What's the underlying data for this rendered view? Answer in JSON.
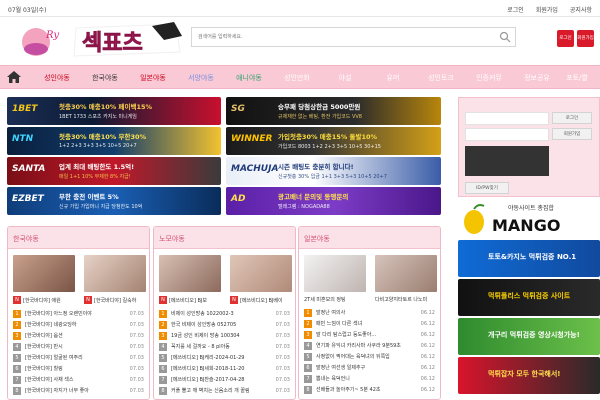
{
  "top": {
    "date": "07월 03일(수)",
    "links": [
      "로그인",
      "회원가입",
      "공지사항"
    ]
  },
  "logo": {
    "script": "Ry",
    "text": "섹표츠"
  },
  "search": {
    "placeholder": "검색어를 입력하세요."
  },
  "header_buttons": [
    "로그인",
    "회원가입"
  ],
  "nav": {
    "items": [
      "성인야동",
      "한국야동",
      "일본야동",
      "서양야동",
      "애니야동",
      "성인만화",
      "야설",
      "유머",
      "성인토크",
      "인증커뮤",
      "정보공유",
      "포토/짤"
    ]
  },
  "banners": [
    {
      "brand": "1BET",
      "title": "첫충30% 매충10% 페이백15%",
      "sub": "1BET 1733 스포츠 카지노 미니게임"
    },
    {
      "brand": "SG",
      "title": "승무패 당첨상한금 5000만원",
      "sub": "규제재한 없는 베팅, 환전  가입코드 VV8"
    },
    {
      "brand": "NTN",
      "title": "첫충30% 매충10% 무한30%",
      "sub": "1+2 2+3 3+3 3+5 10+5 20+7"
    },
    {
      "brand": "WINNER",
      "title": "가입첫충30% 매충15% 돌발10%",
      "sub": "가입코드 8003 1+2 2+3 3+5 10+5 30+15"
    },
    {
      "brand": "SANTA",
      "title": "업계 최대 배팅한도 1.5억!",
      "sub": "매일 1+1 10% 무제한 8% 지급!"
    },
    {
      "brand": "MACHUJA",
      "title": "시즌 배팅도 충분히 합니다!",
      "sub": "신규첫충 30% 입금 1+1 3+3 5+3 10+5 20+7"
    },
    {
      "brand": "EZBET",
      "title": "무한 충전 이벤트 5%",
      "sub": "신규 가입 가입머니 지급 당첨한도 10억"
    },
    {
      "brand": "AD",
      "title": "광고배너 문의및 동맹문의",
      "sub": "텔레그램 : NOGADA88"
    }
  ],
  "columns": [
    {
      "title": "한국야동",
      "thumbs": [
        {
          "label": "[한국바디야] 애원"
        },
        {
          "label": "[한국바디야] 길숙하"
        }
      ],
      "rows": [
        {
          "n": "1",
          "t": "[한국바디야] 아느정 오렌민이야",
          "d": "07.03"
        },
        {
          "n": "2",
          "t": "[한국바디야] 네광오딩하",
          "d": "07.03"
        },
        {
          "n": "3",
          "t": "[한국바디야] 옵션",
          "d": "07.03"
        },
        {
          "n": "4",
          "t": "[한국바디야] 반시",
          "d": "07.03"
        },
        {
          "n": "5",
          "t": "[한국바디야] 얼굴된 여주리",
          "d": "07.03"
        },
        {
          "n": "6",
          "t": "[한국바디야] 힐링",
          "d": "07.03"
        },
        {
          "n": "7",
          "t": "[한국바디야] 사채 섹스",
          "d": "07.03"
        },
        {
          "n": "8",
          "t": "[한국바디야] 자지가 너무 좋아",
          "d": "07.03"
        }
      ]
    },
    {
      "title": "노모야동",
      "thumbs": [
        {
          "label": "[메쓰비디오] BJ보"
        },
        {
          "label": "[메쓰비디오] BJ베이"
        }
      ],
      "rows": [
        {
          "n": "1",
          "t": "비제이 성인방송 1022002-3",
          "d": "07.03"
        },
        {
          "n": "2",
          "t": "한국 비제이 성인방송 052705",
          "d": "07.03"
        },
        {
          "n": "3",
          "t": "19금 성인 비제이 방송 100304",
          "d": "07.03"
        },
        {
          "n": "4",
          "t": "꼭지를 세 걸까요 - 8 pl아동",
          "d": "07.03"
        },
        {
          "n": "5",
          "t": "[메쓰비디오] BJ케리-2024-01-29",
          "d": "07.03"
        },
        {
          "n": "6",
          "t": "[메쓰비디오] BJ세희-2018-11-20",
          "d": "07.03"
        },
        {
          "n": "7",
          "t": "[메쓰비디오] BJ찬슬-2017-04-28",
          "d": "07.03"
        },
        {
          "n": "8",
          "t": "커플 뿔고 깨 벽치는 신음소리 개 꼴림",
          "d": "07.03"
        }
      ]
    },
    {
      "title": "일본야동",
      "thumbs": [
        {
          "label": "2T세 미혼모의 정팅"
        },
        {
          "label": "다비고양지타토르 나노미"
        }
      ],
      "rows": [
        {
          "n": "1",
          "t": "발정난 여의사",
          "d": "06.12"
        },
        {
          "n": "2",
          "t": "패빈 느낌이 다른 섹녀",
          "d": "06.12"
        },
        {
          "n": "3",
          "t": "말 다리 탐스럽고 등도좋아...",
          "d": "06.12"
        },
        {
          "n": "4",
          "t": "연기파 유익녀 카리사마 사쿠라 9분59초",
          "d": "06.12"
        },
        {
          "n": "5",
          "t": "사정없이 찍어대는 육덕녀의 뒤쪽입",
          "d": "06.12"
        },
        {
          "n": "6",
          "t": "발정난 여선생 일제추구",
          "d": "06.12"
        },
        {
          "n": "7",
          "t": "뽐내는 육덕언니",
          "d": "06.12"
        },
        {
          "n": "8",
          "t": "선배들과 놀아주기~ 5분 42초",
          "d": "06.12"
        }
      ]
    }
  ],
  "login": {
    "login_btn": "로그인",
    "join_btn": "회원가입",
    "find_btn": "ID/PW찾기"
  },
  "mango": {
    "top": "야동사이트 총집합",
    "brand": "MANGO"
  },
  "side_banners": [
    {
      "text": "토토&카지노 먹튀검증 NO.1"
    },
    {
      "text": "먹튀폴리스 먹튀검증 사이트"
    },
    {
      "text": "개구리 먹튀검증 영상시청가능!"
    },
    {
      "text": "먹튀잡자 모두 한국해서!"
    }
  ]
}
